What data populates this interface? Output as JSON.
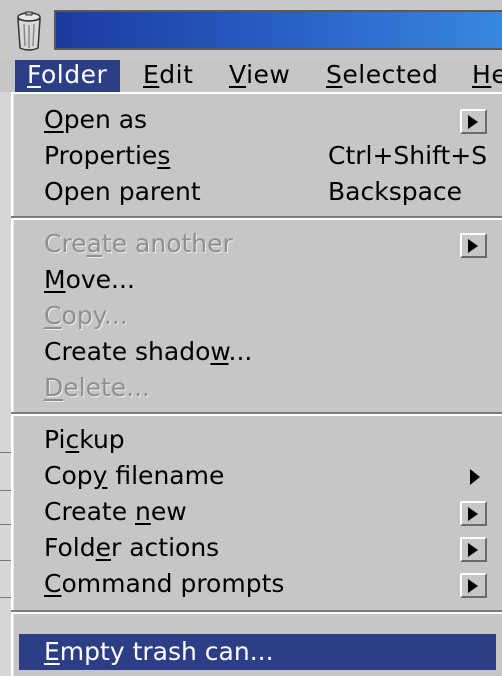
{
  "titlebar": {
    "icon": "trash-can-icon"
  },
  "menubar": {
    "items": [
      {
        "id": "folder",
        "pre": "",
        "u": "F",
        "post": "older",
        "active": true
      },
      {
        "id": "edit",
        "pre": "",
        "u": "E",
        "post": "dit"
      },
      {
        "id": "view",
        "pre": "",
        "u": "V",
        "post": "iew"
      },
      {
        "id": "selected",
        "pre": "",
        "u": "S",
        "post": "elected"
      },
      {
        "id": "help",
        "pre": "",
        "u": "H",
        "post": "e"
      }
    ]
  },
  "menu": {
    "items": [
      {
        "pre": "",
        "u": "O",
        "post": "pen as",
        "accel": "",
        "submenu": "boxed",
        "enabled": true
      },
      {
        "pre": "Propertie",
        "u": "s",
        "post": "",
        "accel": "Ctrl+Shift+S",
        "submenu": "",
        "enabled": true
      },
      {
        "pre": "Open parent",
        "u": "",
        "post": "",
        "accel": "Backspace",
        "submenu": "",
        "enabled": true
      },
      {
        "pre": "Cre",
        "u": "a",
        "post": "te another",
        "accel": "",
        "submenu": "boxed",
        "enabled": false
      },
      {
        "pre": "",
        "u": "M",
        "post": "ove...",
        "accel": "",
        "submenu": "",
        "enabled": true
      },
      {
        "pre": "",
        "u": "C",
        "post": "opy...",
        "accel": "",
        "submenu": "",
        "enabled": false
      },
      {
        "pre": "Create shado",
        "u": "w",
        "post": "...",
        "accel": "",
        "submenu": "",
        "enabled": true
      },
      {
        "pre": "",
        "u": "D",
        "post": "elete...",
        "accel": "",
        "submenu": "",
        "enabled": false
      },
      {
        "pre": "Pi",
        "u": "c",
        "post": "kup",
        "accel": "",
        "submenu": "",
        "enabled": true
      },
      {
        "pre": "Cop",
        "u": "y",
        "post": " filename",
        "accel": "",
        "submenu": "plain",
        "enabled": true
      },
      {
        "pre": "Create ",
        "u": "n",
        "post": "ew",
        "accel": "",
        "submenu": "boxed",
        "enabled": true
      },
      {
        "pre": "Fold",
        "u": "e",
        "post": "r actions",
        "accel": "",
        "submenu": "boxed",
        "enabled": true
      },
      {
        "pre": "",
        "u": "C",
        "post": "ommand prompts",
        "accel": "",
        "submenu": "boxed",
        "enabled": true
      },
      {
        "pre": "",
        "u": "E",
        "post": "mpty trash can...",
        "accel": "",
        "submenu": "",
        "enabled": true,
        "highlighted": true
      }
    ]
  }
}
